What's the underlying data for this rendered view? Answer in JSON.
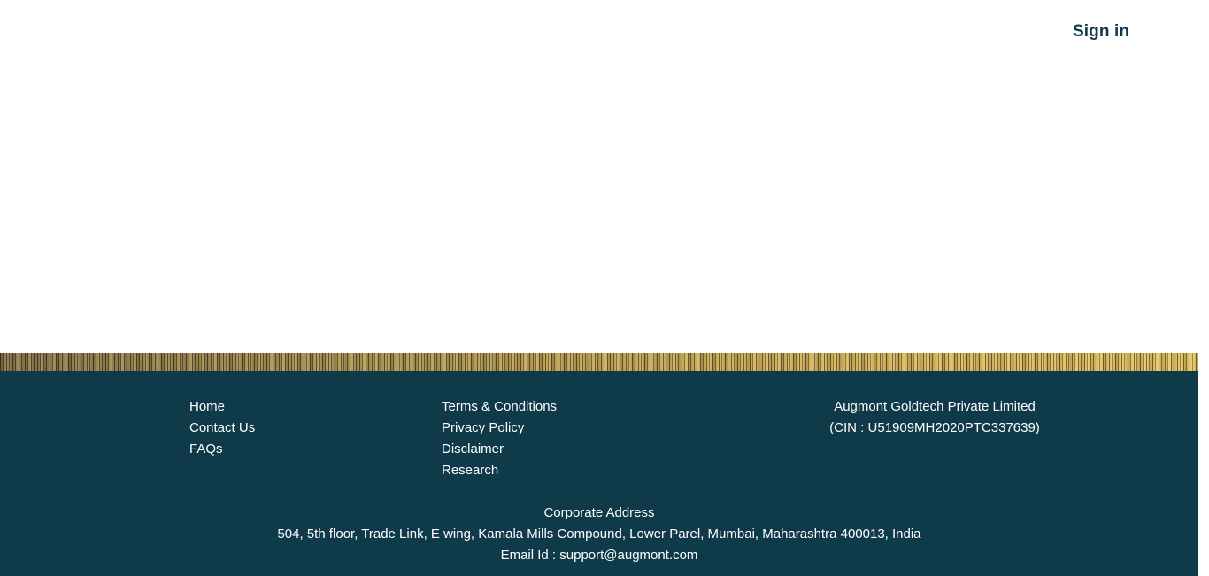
{
  "header": {
    "signin_label": "Sign in"
  },
  "footer": {
    "links_col1": [
      "Home",
      "Contact Us",
      "FAQs"
    ],
    "links_col2": [
      "Terms & Conditions",
      "Privacy Policy",
      "Disclaimer",
      "Research"
    ],
    "company": {
      "name": "Augmont Goldtech Private Limited",
      "cin": "(CIN : U51909MH2020PTC337639)"
    },
    "address": {
      "heading": "Corporate Address",
      "line": "504, 5th floor, Trade Link, E wing, Kamala Mills Compound, Lower Parel, Mumbai, Maharashtra 400013, India",
      "email_prefix": "Email Id : ",
      "email": "support@augmont.com"
    }
  },
  "colors": {
    "footer_bg": "#0f3a49",
    "signin_text": "#0f3a49",
    "footer_text": "#ffffff"
  }
}
